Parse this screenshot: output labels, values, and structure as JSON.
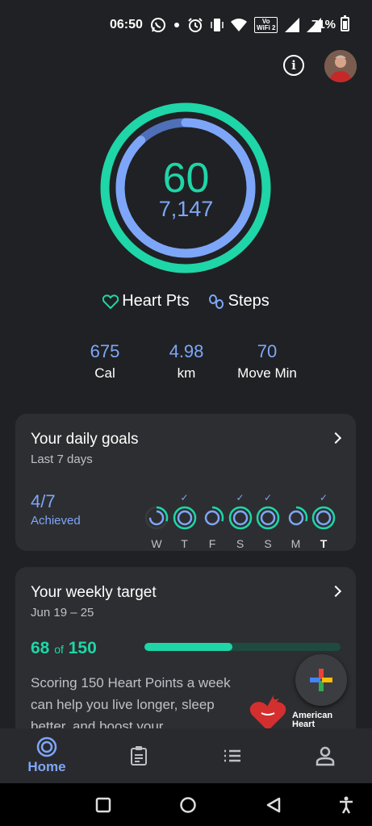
{
  "status": {
    "time": "06:50",
    "battery": "71%",
    "wifi_badge_line1": "Vo",
    "wifi_badge_line2": "WiFi 2"
  },
  "summary": {
    "heart_points": "60",
    "steps": "7,147",
    "legend_heart": "Heart Pts",
    "legend_steps": "Steps",
    "stats": [
      {
        "value": "675",
        "label": "Cal"
      },
      {
        "value": "4.98",
        "label": "km"
      },
      {
        "value": "70",
        "label": "Move Min"
      }
    ]
  },
  "daily_goals": {
    "title": "Your daily goals",
    "subtitle": "Last 7 days",
    "achieved_count": "4/7",
    "achieved_label": "Achieved",
    "days": [
      {
        "label": "W",
        "achieved": false,
        "today": false
      },
      {
        "label": "T",
        "achieved": true,
        "today": false
      },
      {
        "label": "F",
        "achieved": false,
        "today": false
      },
      {
        "label": "S",
        "achieved": true,
        "today": false
      },
      {
        "label": "S",
        "achieved": true,
        "today": false
      },
      {
        "label": "M",
        "achieved": false,
        "today": false
      },
      {
        "label": "T",
        "achieved": true,
        "today": true
      }
    ]
  },
  "weekly_target": {
    "title": "Your weekly target",
    "date_range": "Jun 19 – 25",
    "current": "68",
    "of_label": "of",
    "goal": "150",
    "progress_fraction": 0.45,
    "description": "Scoring 150 Heart Points a week can help you live longer, sleep better, and boost your",
    "partner_line1": "American",
    "partner_line2": "Heart"
  },
  "nav": {
    "items": [
      {
        "label": "Home",
        "icon": "home-rings-icon",
        "active": true
      },
      {
        "label": "",
        "icon": "journal-icon",
        "active": false
      },
      {
        "label": "",
        "icon": "browse-list-icon",
        "active": false
      },
      {
        "label": "",
        "icon": "profile-icon",
        "active": false
      }
    ]
  },
  "colors": {
    "heart_green": "#1ed6a7",
    "steps_blue": "#7ea6f8",
    "background": "#202124",
    "card": "#2d2e31"
  }
}
